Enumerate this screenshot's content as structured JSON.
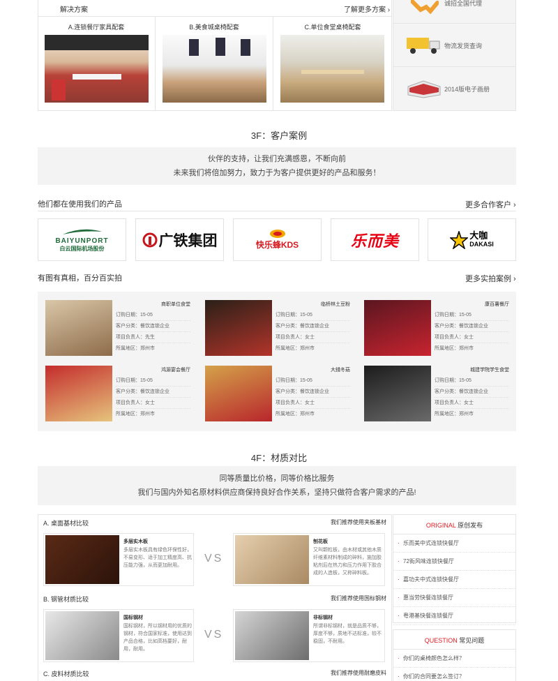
{
  "solutions": {
    "title": "解决方案",
    "more": "了解更多方案",
    "items": [
      {
        "label": "A.连锁餐厅家具配套"
      },
      {
        "label": "B.美食城桌椅配套"
      },
      {
        "label": "C.单位食堂桌椅配套"
      }
    ]
  },
  "side_services": {
    "items": [
      {
        "label": "诚招全国代理",
        "icon": "handshake-icon"
      },
      {
        "label": "物流发货查询",
        "icon": "truck-icon"
      },
      {
        "label": "2014版电子画册",
        "icon": "brochure-icon"
      }
    ]
  },
  "f3": {
    "title": "3F：客户案例",
    "intro_line1": "伙伴的支持，让我们充满感恩，不断向前",
    "intro_line2": "未来我们将倍加努力，致力于为客户提供更好的产品和服务！",
    "partners_title": "他们都在使用我们的产品",
    "partners_more": "更多合作客户",
    "partners": [
      {
        "name": "BAIYUNPORT 白云国际机场股份",
        "word": "BAIYUNPORT",
        "sub": "白云国际机场股份",
        "color": "#1f6b3a"
      },
      {
        "name": "广铁集团",
        "word": "广铁集团",
        "color": "#111111",
        "accent": "#c8161d"
      },
      {
        "name": "快乐蜂 KDS",
        "word": "快乐蜂KDS",
        "color": "#d71920",
        "accent": "#f5a400"
      },
      {
        "name": "乐而美",
        "word": "乐而美",
        "color": "#e60012"
      },
      {
        "name": "大咖 DAKASI",
        "word": "大咖",
        "sub": "DAKASI",
        "color": "#000000",
        "accent": "#f7c600"
      }
    ],
    "photos_title": "有图有真相，百分百实拍",
    "photos_more": "更多实拍案例",
    "cases": [
      {
        "title": "商职单位食堂",
        "date": "订购日期：15-05",
        "cat": "客户分类：餐饮连锁企业",
        "owner": "项目负责人：先生",
        "region": "所属地区：郑州市",
        "bg1": "#d9c7a7",
        "bg2": "#8d6b4a"
      },
      {
        "title": "临桥林土豆粉",
        "date": "订购日期：15-05",
        "cat": "客户分类：餐饮连锁企业",
        "owner": "项目负责人：女士",
        "region": "所属地区：郑州市",
        "bg1": "#2a2018",
        "bg2": "#b3342a"
      },
      {
        "title": "康百薯餐厅",
        "date": "订购日期：15-05",
        "cat": "客户分类：餐饮连锁企业",
        "owner": "项目负责人：女士",
        "region": "所属地区：郑州市",
        "bg1": "#5a1620",
        "bg2": "#c8242f"
      },
      {
        "title": "鸿源宴会餐厅",
        "date": "订购日期：15-05",
        "cat": "客户分类：餐饮连锁企业",
        "owner": "项目负责人：女士",
        "region": "所属地区：郑州市",
        "bg1": "#c42c2c",
        "bg2": "#e6c47d"
      },
      {
        "title": "大錢冬菇",
        "date": "订购日期：15-05",
        "cat": "客户分类：餐饮连锁企业",
        "owner": "项目负责人：女士",
        "region": "所属地区：郑州市",
        "bg1": "#d4a24a",
        "bg2": "#b8262c"
      },
      {
        "title": "城建学院学生食堂",
        "date": "订购日期：15-05",
        "cat": "客户分类：餐饮连锁企业",
        "owner": "项目负责人：女士",
        "region": "所属地区：郑州市",
        "bg1": "#1c1c1c",
        "bg2": "#6a6a6a"
      }
    ]
  },
  "f4": {
    "title": "4F：材质对比",
    "intro_line1": "同等质量比价格，同等价格比服务",
    "intro_line2": "我们与国内外知名原材料供应商保持良好合作关系，坚持只做符合客户需求的产品!",
    "vs": "VS",
    "rows": [
      {
        "label": "A. 桌面基材比较",
        "recommend": "我们推荐使用夹板基材",
        "left_title": "多层实木板",
        "left_desc": "多层实木板具有绿色环保性好，不易变形、适于加工精度高、抗压能力强，从而更加耐用。",
        "right_title": "刨花板",
        "right_desc": "又叫颗粒板，由木材或其他木质纤维素材料制成的碎料，施加胶粘剂后在热力和压力作用下胶合成的人造板，又称碎料板。",
        "left_c1": "#5a2a16",
        "left_c2": "#2c130a",
        "right_c1": "#e6cfae",
        "right_c2": "#a98a63"
      },
      {
        "label": "B. 钢管材质比较",
        "recommend": "我们推荐使用国标钢材",
        "left_title": "国标钢材",
        "left_desc": "国标钢材，所以钢材用的优质的钢材，符合国家标准，使用达到产品合格，比如高档要好，耐用，耐用。",
        "right_title": "非标钢材",
        "right_desc": "所谓非标钢材，就是品质不够，厚度不够，质地不达标准，较不稳固，不耐用。",
        "left_c1": "#e8e8e8",
        "left_c2": "#8a8a8a",
        "right_c1": "#d5d5d5",
        "right_c2": "#6d6d6d"
      },
      {
        "label": "C. 皮料材质比较",
        "recommend": "我们推荐使用耐磨皮料"
      }
    ]
  },
  "news": {
    "original": {
      "head_en": "ORIGINAL",
      "head_cn": "原创发布",
      "items": [
        "乐而美中式连锁快餐厅",
        "72街风味连锁快餐厅",
        "嘉功夫中式连锁快餐厅",
        "惠当劳快餐连锁餐厅",
        "粤港基快餐连锁餐厅"
      ]
    },
    "question": {
      "head_en": "QUESTION",
      "head_cn": "常见问题",
      "items": [
        "你们的桌椅颜色怎么样？",
        "你们的合同要怎么签订？"
      ]
    }
  },
  "colors": {
    "accent_red": "#e31b23",
    "border": "#e5e5e5",
    "panel": "#f4f4f4"
  }
}
